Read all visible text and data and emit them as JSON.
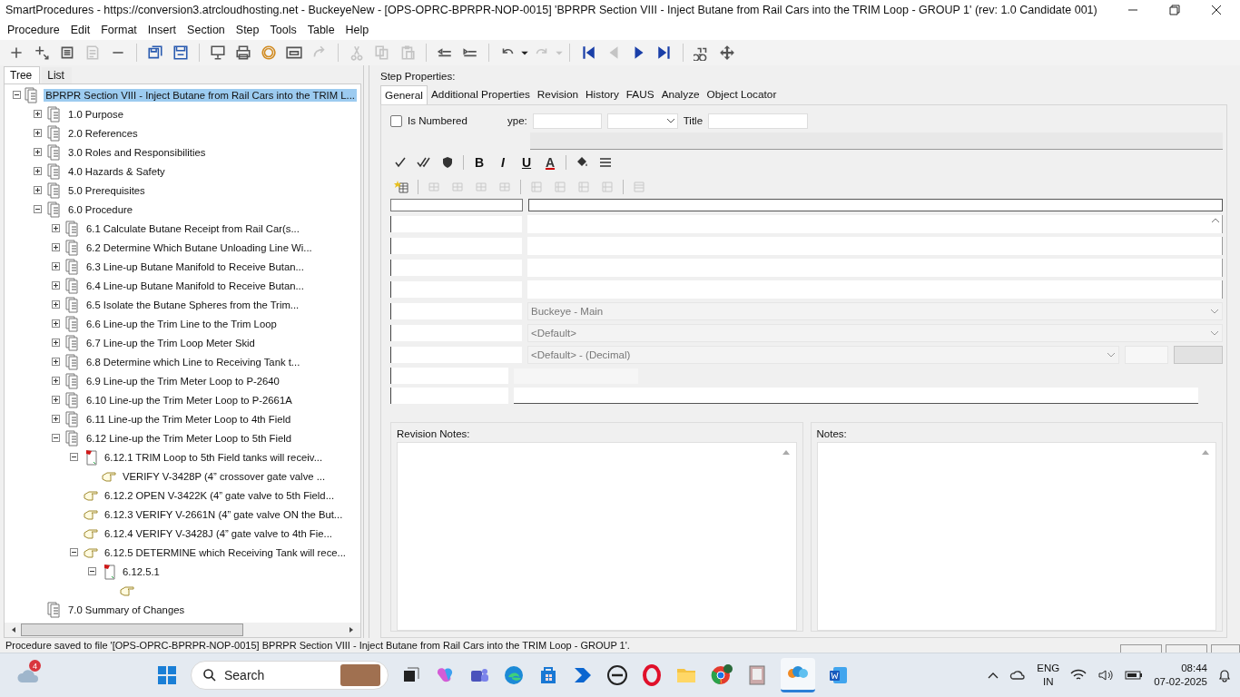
{
  "window": {
    "title": "SmartProcedures - https://conversion3.atrcloudhosting.net - BuckeyeNew - [OPS-OPRC-BPRPR-NOP-0015] 'BPRPR Section VIII - Inject Butane from Rail Cars into the TRIM Loop - GROUP 1' (rev: 1.0 Candidate 001)"
  },
  "menu": [
    "Procedure",
    "Edit",
    "Format",
    "Insert",
    "Section",
    "Step",
    "Tools",
    "Table",
    "Help"
  ],
  "toolbar": [
    [
      {
        "kind": "add",
        "disabled": false
      },
      {
        "kind": "add-child",
        "disabled": false
      },
      {
        "kind": "outline",
        "disabled": false
      },
      {
        "kind": "text",
        "disabled": true
      },
      {
        "kind": "remove",
        "disabled": false
      }
    ],
    [
      {
        "kind": "save-all",
        "disabled": false
      },
      {
        "kind": "save",
        "disabled": false
      }
    ],
    [
      {
        "kind": "monitor",
        "disabled": false
      },
      {
        "kind": "print",
        "disabled": false
      },
      {
        "kind": "ring",
        "disabled": false
      },
      {
        "kind": "window",
        "disabled": false
      },
      {
        "kind": "forward",
        "disabled": true
      }
    ],
    [
      {
        "kind": "cut",
        "disabled": true
      },
      {
        "kind": "copy",
        "disabled": true
      },
      {
        "kind": "paste",
        "disabled": true
      }
    ],
    [
      {
        "kind": "outdent",
        "disabled": false
      },
      {
        "kind": "indent",
        "disabled": false
      }
    ],
    [
      {
        "kind": "undo",
        "disabled": false
      },
      {
        "kind": "caret",
        "disabled": false
      },
      {
        "kind": "redo",
        "disabled": true
      },
      {
        "kind": "caret",
        "disabled": true
      }
    ],
    [
      {
        "kind": "first",
        "disabled": false
      },
      {
        "kind": "prev",
        "disabled": true
      },
      {
        "kind": "next",
        "disabled": false
      },
      {
        "kind": "last",
        "disabled": false
      }
    ],
    [
      {
        "kind": "find",
        "disabled": false
      },
      {
        "kind": "move",
        "disabled": false
      }
    ]
  ],
  "tree": {
    "tabs": [
      {
        "label": "Tree",
        "selected": true
      },
      {
        "label": "List",
        "selected": false
      }
    ],
    "items": [
      {
        "label": "BPRPR Section VIII - Inject Butane from Rail Cars into the TRIM L...",
        "kind": "section",
        "expanded": true,
        "selected": true,
        "children": [
          {
            "label": "1.0 Purpose",
            "kind": "section",
            "expanded": false,
            "selected": false
          },
          {
            "label": "2.0 References",
            "kind": "section",
            "expanded": false,
            "selected": false
          },
          {
            "label": "3.0 Roles and Responsibilities",
            "kind": "section",
            "expanded": false,
            "selected": false
          },
          {
            "label": "4.0 Hazards & Safety",
            "kind": "section",
            "expanded": false,
            "selected": false
          },
          {
            "label": "5.0 Prerequisites",
            "kind": "section",
            "expanded": false,
            "selected": false
          },
          {
            "label": "6.0 Procedure",
            "kind": "section",
            "expanded": true,
            "selected": false,
            "children": [
              {
                "label": "6.1 Calculate Butane Receipt from Rail Car(s...",
                "kind": "section",
                "expanded": false,
                "selected": false
              },
              {
                "label": "6.2 Determine Which Butane Unloading Line Wi...",
                "kind": "section",
                "expanded": false,
                "selected": false
              },
              {
                "label": "6.3 Line-up Butane Manifold to Receive Butan...",
                "kind": "section",
                "expanded": false,
                "selected": false
              },
              {
                "label": "6.4 Line-up Butane Manifold to Receive Butan...",
                "kind": "section",
                "expanded": false,
                "selected": false
              },
              {
                "label": "6.5 Isolate the Butane Spheres from the Trim...",
                "kind": "section",
                "expanded": false,
                "selected": false
              },
              {
                "label": "6.6 Line-up the Trim Line to the Trim Loop",
                "kind": "section",
                "expanded": false,
                "selected": false
              },
              {
                "label": "6.7 Line-up the Trim Loop Meter Skid",
                "kind": "section",
                "expanded": false,
                "selected": false
              },
              {
                "label": "6.8 Determine which Line to Receiving Tank t...",
                "kind": "section",
                "expanded": false,
                "selected": false
              },
              {
                "label": "6.9 Line-up the Trim Meter Loop to P-2640",
                "kind": "section",
                "expanded": false,
                "selected": false
              },
              {
                "label": "6.10 Line-up the Trim Meter Loop to P-2661A",
                "kind": "section",
                "expanded": false,
                "selected": false
              },
              {
                "label": "6.11 Line-up the Trim Meter Loop to 4th Field",
                "kind": "section",
                "expanded": false,
                "selected": false
              },
              {
                "label": "6.12 Line-up the Trim Meter Loop to 5th Field",
                "kind": "section",
                "expanded": true,
                "selected": false,
                "children": [
                  {
                    "label": "6.12.1 TRIM Loop to 5th Field tanks will receiv...",
                    "kind": "step",
                    "expanded": true,
                    "selected": false,
                    "children": [
                      {
                        "label": "VERIFY V-3428P (4” crossover gate valve ...",
                        "kind": "action",
                        "selected": false
                      }
                    ]
                  },
                  {
                    "label": "6.12.2 OPEN V-3422K (4” gate valve to 5th Field...",
                    "kind": "action",
                    "selected": false
                  },
                  {
                    "label": "6.12.3 VERIFY V-2661N (4” gate valve ON the But...",
                    "kind": "action",
                    "selected": false
                  },
                  {
                    "label": "6.12.4 VERIFY V-3428J (4” gate valve to 4th Fie...",
                    "kind": "action",
                    "selected": false
                  },
                  {
                    "label": "6.12.5 DETERMINE which Receiving Tank will rece...",
                    "kind": "action",
                    "expanded": true,
                    "selected": false,
                    "children": [
                      {
                        "label": "6.12.5.1",
                        "kind": "step",
                        "expanded": true,
                        "selected": false,
                        "children": [
                          {
                            "kind": "action",
                            "selected": false
                          }
                        ]
                      }
                    ]
                  }
                ]
              }
            ]
          },
          {
            "label": "7.0 Summary of Changes",
            "kind": "section",
            "selected": false
          }
        ]
      }
    ]
  },
  "properties": {
    "heading": "Step Properties:",
    "tabs": [
      {
        "label": "General",
        "selected": true
      },
      {
        "label": "Additional Properties",
        "selected": false
      },
      {
        "label": "Revision",
        "selected": false
      },
      {
        "label": "History",
        "selected": false
      },
      {
        "label": "FAUS",
        "selected": false
      },
      {
        "label": "Analyze",
        "selected": false
      },
      {
        "label": "Object Locator",
        "selected": false
      }
    ],
    "is_numbered": {
      "label": "Is Numbered",
      "checked": false
    },
    "type_label": "ype:",
    "title_label": "Title",
    "format_row_1": [
      {
        "kind": "check"
      },
      {
        "kind": "double-check"
      },
      {
        "kind": "shield"
      },
      {
        "kind": "letter",
        "label": "B"
      },
      {
        "kind": "letter",
        "label": "I"
      },
      {
        "kind": "letter",
        "label": "U"
      },
      {
        "kind": "letter",
        "label": "A"
      },
      {
        "kind": "fill"
      },
      {
        "kind": "align"
      }
    ],
    "dropdowns": [
      {
        "value": "Buckeye - Main",
        "disabled": true
      },
      {
        "value": "<Default>",
        "disabled": true
      },
      {
        "value": "<Default> - (Decimal)",
        "disabled": true
      }
    ],
    "revision_notes_label": "Revision Notes:",
    "notes_label": "Notes:"
  },
  "status_bar": {
    "message": "Procedure saved to file '[OPS-OPRC-BPRPR-NOP-0015] BPRPR Section VIII - Inject Butane from Rail Cars into the TRIM Loop - GROUP 1'."
  },
  "taskbar": {
    "weather_badge": "4",
    "search_placeholder": "Search",
    "language": "ENG",
    "region": "IN",
    "time": "08:44",
    "date": "07-02-2025"
  }
}
